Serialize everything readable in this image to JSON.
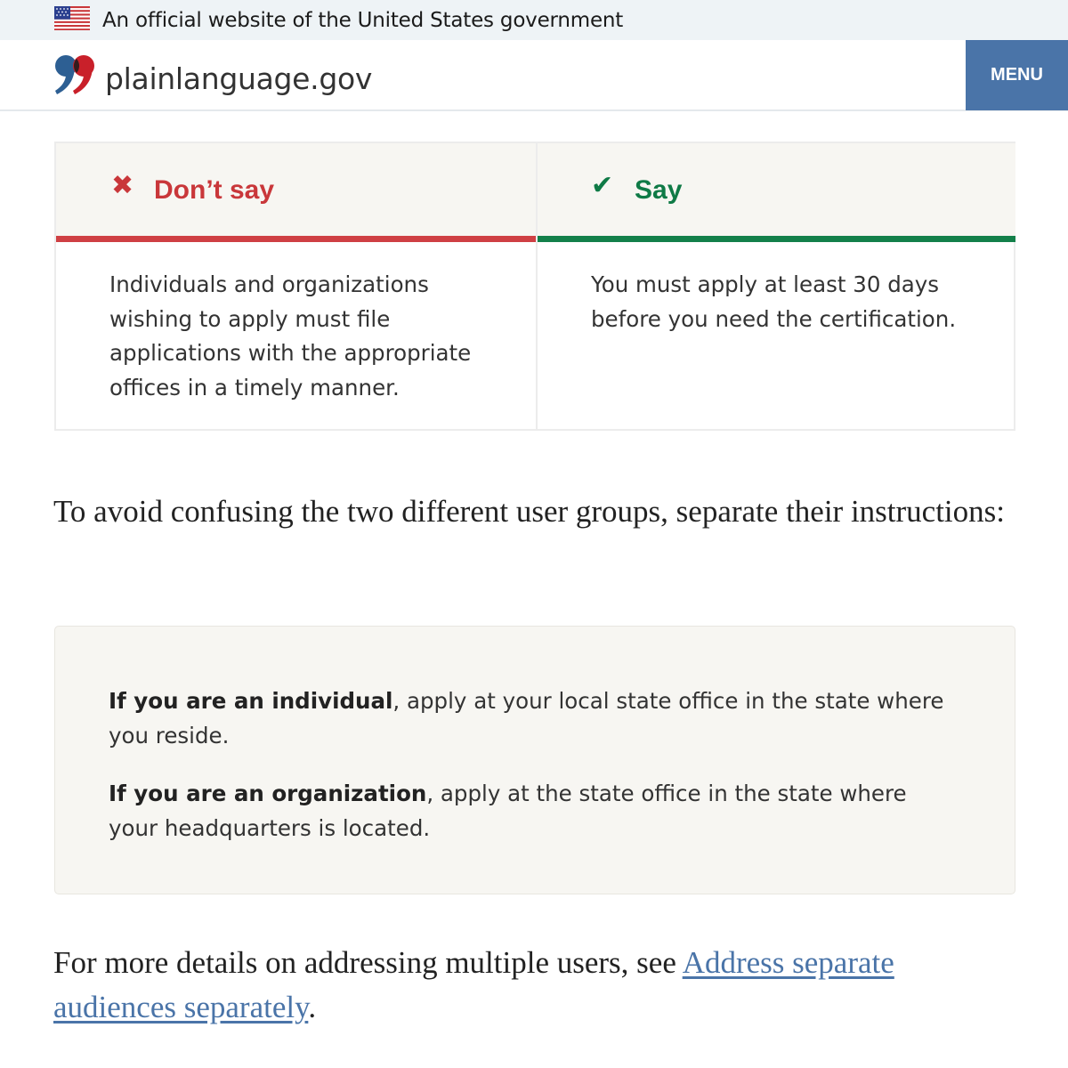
{
  "gov_banner": {
    "text": "An official website of the United States government",
    "icon": "us-flag-icon"
  },
  "header": {
    "site_name": "plainlanguage.gov",
    "logo_icon": "quote-marks-logo-icon",
    "menu_label": "MENU",
    "colors": {
      "menu_bg": "#4a74a8"
    }
  },
  "comparison": {
    "dont": {
      "icon": "x-mark-icon",
      "heading": "Don’t say",
      "body": "Individuals and organizations wishing to apply must file applications with the appropriate offices in a timely manner.",
      "color": "#c9373a"
    },
    "do": {
      "icon": "check-mark-icon",
      "heading": "Say",
      "body": "You must apply at least 30 days before you need the certification.",
      "color": "#0f7a46"
    }
  },
  "intro_paragraph": "To avoid confusing the two different user groups, separate their instructions:",
  "callout": {
    "item1_bold": "If you are an individual",
    "item1_rest": ", apply at your local state office in the state where you reside.",
    "item2_bold": "If you are an organization",
    "item2_rest": ", apply at the state office in the state where your headquarters is located."
  },
  "details_paragraph": {
    "prefix": "For more details on addressing multiple users, see ",
    "link_text": "Address separate audiences separately",
    "suffix": "."
  }
}
